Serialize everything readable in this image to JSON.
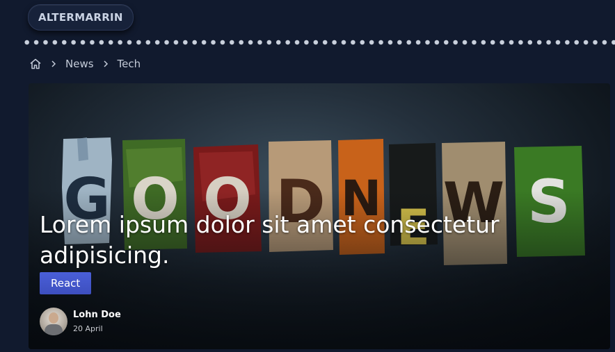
{
  "brand": {
    "label": "ALTERMARRIN"
  },
  "breadcrumb": {
    "items": [
      "News",
      "Tech"
    ]
  },
  "hero": {
    "image_letters": [
      "G",
      "O",
      "O",
      "D",
      "N",
      "E",
      "W",
      "S"
    ],
    "title": "Lorem ipsum dolor sit amet consectetur adipisicing.",
    "tag": "React",
    "author": {
      "name": "Lohn Doe",
      "date": "20 April"
    }
  },
  "colors": {
    "background": "#111a2e",
    "tag": "#4a5fd8",
    "text": "#ffffff"
  }
}
